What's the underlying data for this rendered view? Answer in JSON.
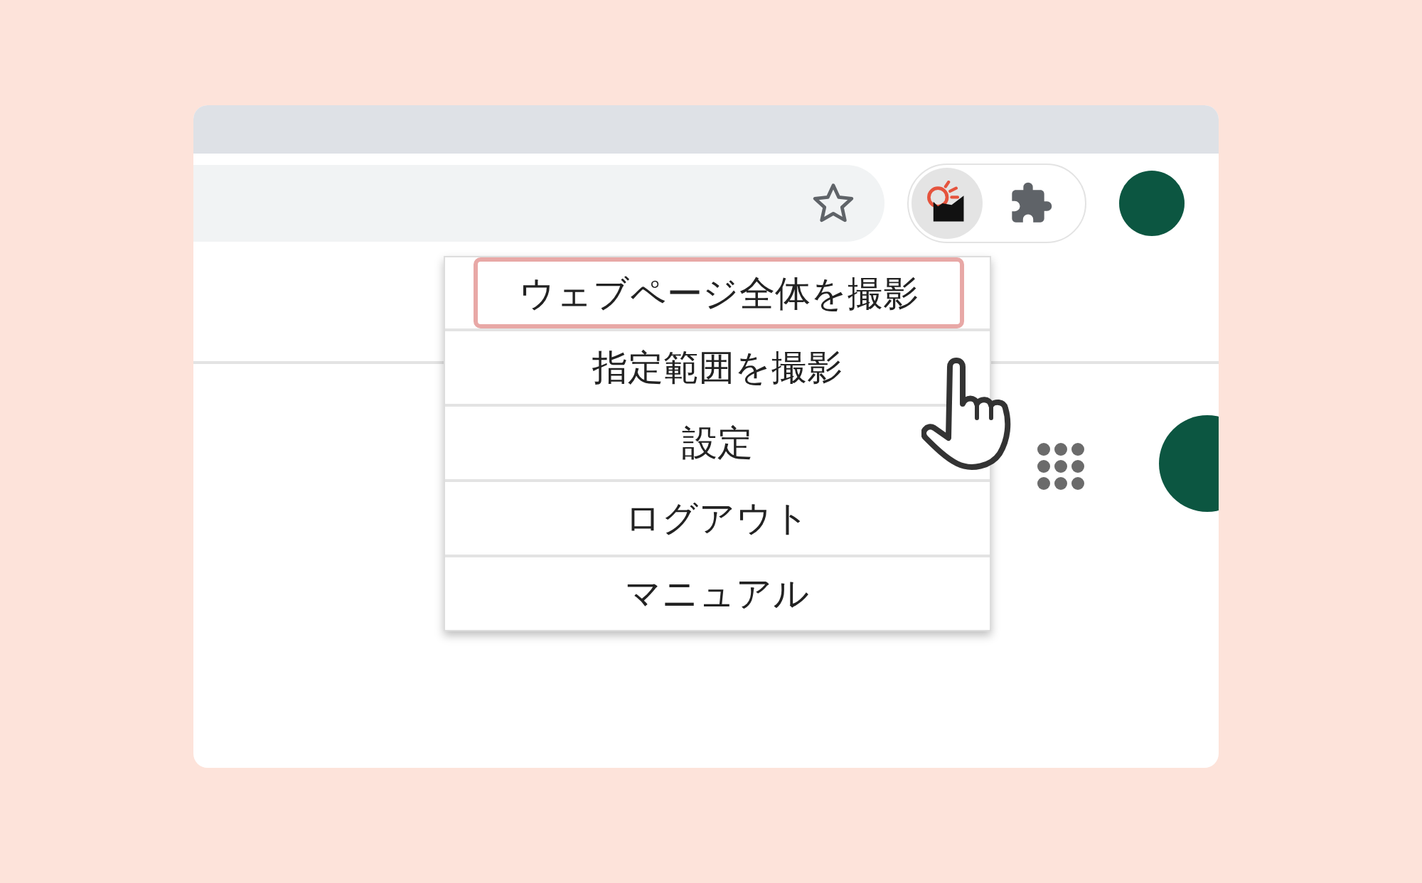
{
  "menu": {
    "items": [
      {
        "label": "ウェブページ全体を撮影",
        "selected": true
      },
      {
        "label": "指定範囲を撮影",
        "selected": false
      },
      {
        "label": "設定",
        "selected": false
      },
      {
        "label": "ログアウト",
        "selected": false
      },
      {
        "label": "マニュアル",
        "selected": false
      }
    ]
  }
}
